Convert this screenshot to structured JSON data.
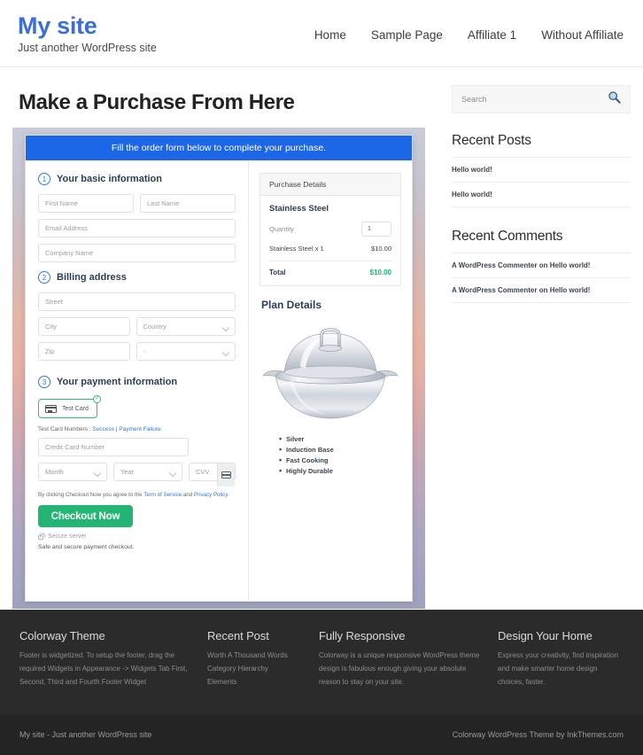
{
  "header": {
    "site_title": "My site",
    "tagline": "Just another WordPress site",
    "nav": [
      {
        "label": "Home"
      },
      {
        "label": "Sample Page"
      },
      {
        "label": "Affiliate 1"
      },
      {
        "label": "Without Affiliate"
      }
    ]
  },
  "main": {
    "page_title": "Make a Purchase From Here",
    "form": {
      "banner": "Fill the order form below to complete your purchase.",
      "steps": [
        {
          "num": "1",
          "label": "Your basic information"
        },
        {
          "num": "2",
          "label": "Billing address"
        },
        {
          "num": "3",
          "label": "Your payment information"
        }
      ],
      "fields": {
        "first_name": "First Name",
        "last_name": "Last Name",
        "email": "Email Address",
        "company": "Company Name",
        "street": "Street",
        "city": "City",
        "country": "Country",
        "zip": "Zip",
        "state": "-",
        "credit_card": "Credit Card Number",
        "month": "Month",
        "year": "Year",
        "cvv": "CVV"
      },
      "test_card_button": "Test  Card",
      "test_card_badge": "✓",
      "test_numbers_prefix": "Test Card Numbers : ",
      "test_numbers_success": "Success",
      "test_numbers_divider": " | ",
      "test_numbers_failure": "Payment Failure",
      "terms_prefix": "By clicking Checkout Now you agree to the ",
      "terms_tos": "Term of Service",
      "terms_and": " and ",
      "terms_privacy": "Privacy Policy",
      "checkout_label": "Checkout Now",
      "secure_server": "Secure server",
      "safe_note": "Safe and secure payment checkout.",
      "accent_blue": "#1b67e8",
      "accent_green": "#22b573"
    },
    "purchase_details": {
      "title": "Purchase Details",
      "product": "Stainless Steel",
      "quantity_label": "Quantity",
      "quantity_value": "1",
      "line_item_label": "Stainless Steel x 1",
      "line_item_price": "$10.00",
      "total_label": "Total",
      "total_value": "$10.00",
      "total_color": "#22b573"
    },
    "plan_details": {
      "title": "Plan Details",
      "image_name": "stainless-steel-wok-with-lid",
      "features": [
        "Silver",
        "Induction Base",
        "Fast Cooking",
        "Highly Durable"
      ]
    }
  },
  "sidebar": {
    "search_placeholder": "Search",
    "widgets": [
      {
        "title": "Recent Posts",
        "items": [
          "Hello world!",
          "Hello world!"
        ]
      },
      {
        "title": "Recent Comments",
        "items": [
          "A WordPress Commenter on Hello world!",
          "A WordPress Commenter on Hello world!"
        ]
      }
    ]
  },
  "footer": {
    "columns": [
      {
        "title": "Colorway Theme",
        "text": "Footer is widgetized. To setup the footer, drag the required Widgets in Appearance -> Widgets Tab First, Second, Third and Fourth Footer Widget"
      },
      {
        "title": "Recent Post",
        "items": [
          "Worth A Thousand Words",
          "Category Hierarchy",
          "Elements"
        ]
      },
      {
        "title": "Fully Responsive",
        "text": "Colorway is a unique responsive WordPress theme design is fabulous enough giving your absolute reason to stay on your site."
      },
      {
        "title": "Design Your Home",
        "text": "Express your creativity, find inspiration and make smarter home design choices, faster."
      }
    ],
    "bottom_left": "My site - Just another WordPress site",
    "bottom_right": "Colorway WordPress Theme by InkThemes.com"
  }
}
